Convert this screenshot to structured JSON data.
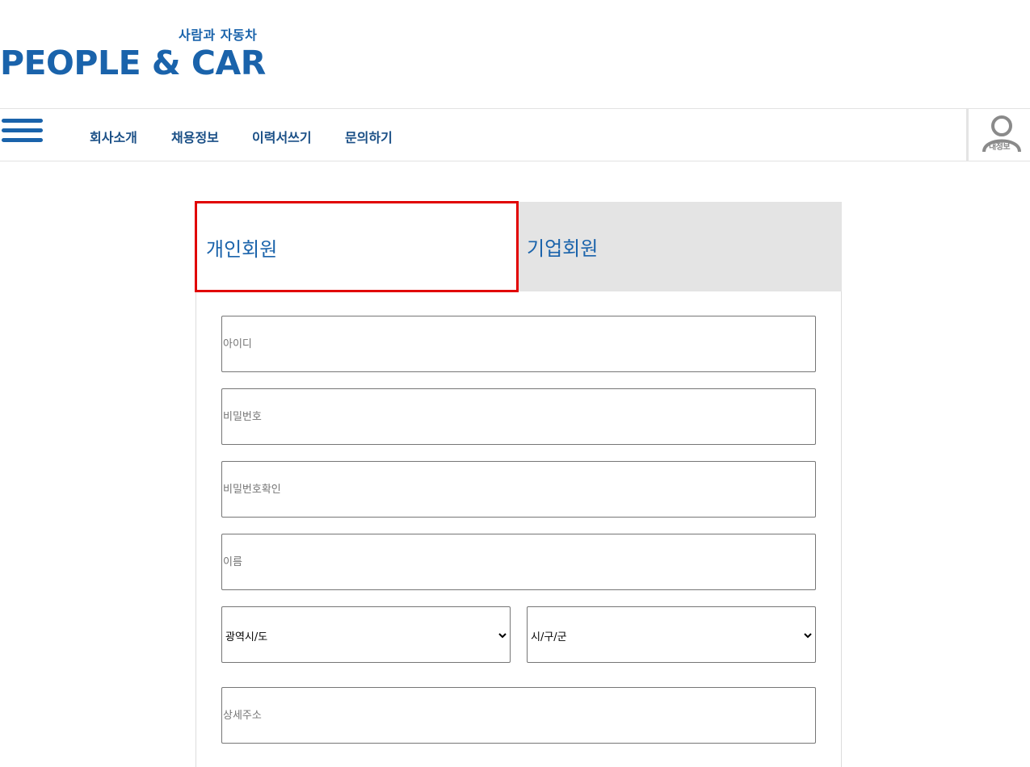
{
  "logo": {
    "subtitle": "사람과 자동차",
    "title": "PEOPLE & CAR"
  },
  "nav": {
    "items": [
      {
        "label": "회사소개"
      },
      {
        "label": "채용정보"
      },
      {
        "label": "이력서쓰기"
      },
      {
        "label": "문의하기"
      }
    ],
    "profile_label": "내정보"
  },
  "tabs": {
    "personal": "개인회원",
    "company": "기업회원",
    "selected": "personal"
  },
  "form": {
    "id_placeholder": "아이디",
    "password_placeholder": "비밀번호",
    "password_confirm_placeholder": "비밀번호확인",
    "name_placeholder": "이름",
    "region_select": "광역시/도",
    "district_select": "시/구/군",
    "address_placeholder": "상세주소"
  },
  "colors": {
    "brand": "#1a63ab",
    "highlight": "#e10000",
    "tab_inactive_bg": "#e4e4e4"
  }
}
